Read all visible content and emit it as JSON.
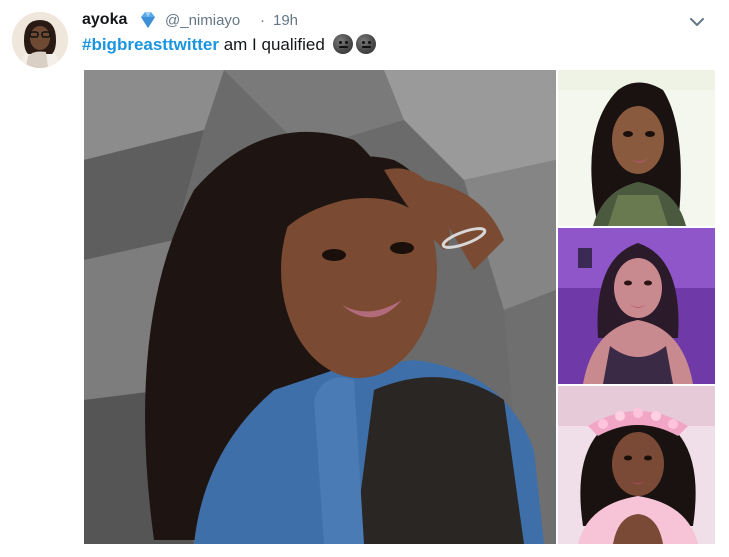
{
  "tweet": {
    "author_name": "ayoka",
    "verified_icon": "diamond-icon",
    "handle": "@_nimiayo",
    "separator": "·",
    "timestamp": "19h",
    "hashtag": "#bigbreasttwitter",
    "text": " am I qualified",
    "emojis": [
      "neutral-face-emoji",
      "neutral-face-emoji"
    ]
  },
  "media": {
    "photos": [
      "main-selfie-photo",
      "photo-2",
      "photo-3",
      "photo-4"
    ]
  },
  "colors": {
    "hashtag": "#1b95e0",
    "secondary_text": "#657786",
    "primary_text": "#14171a"
  }
}
